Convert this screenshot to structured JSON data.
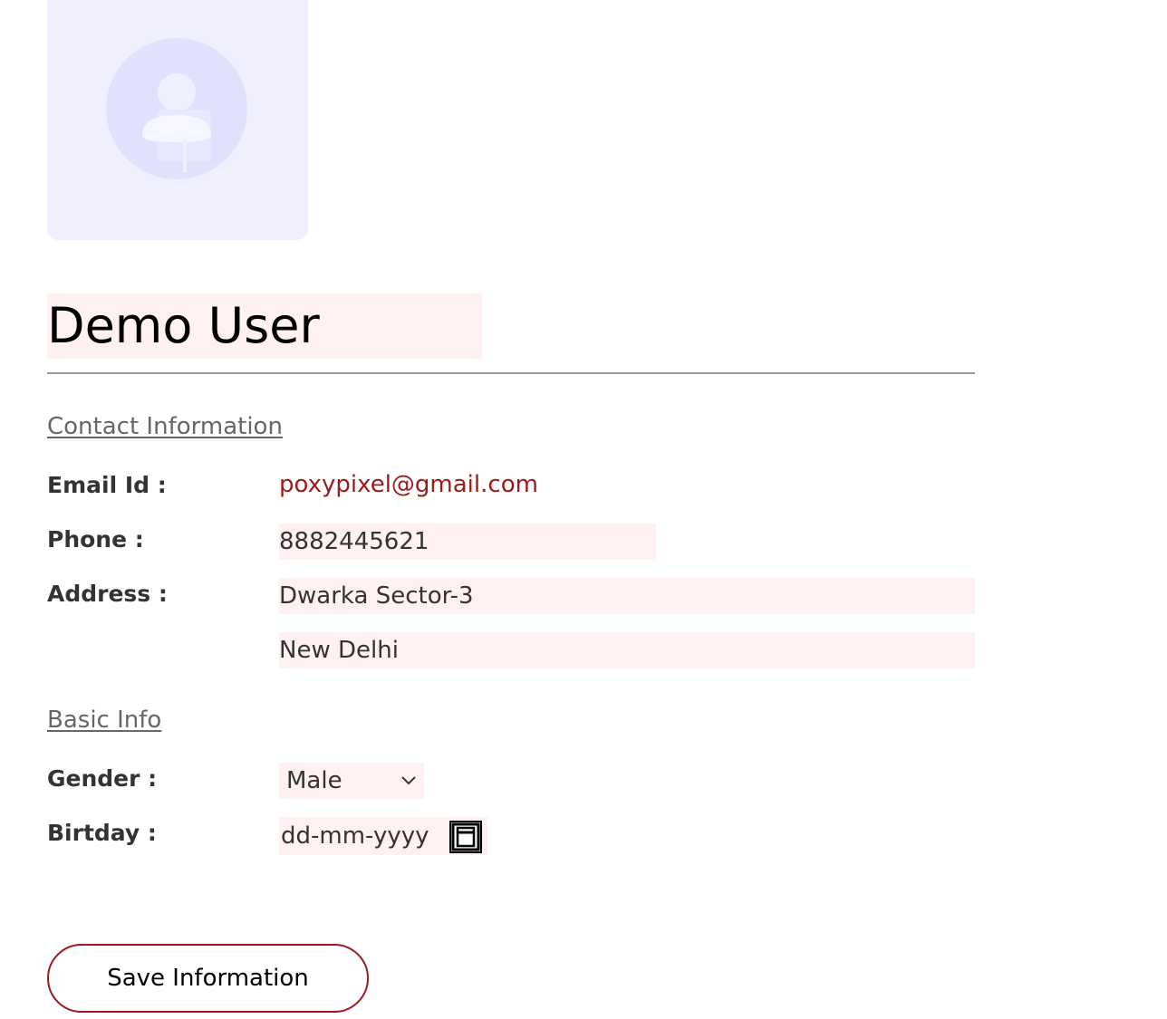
{
  "profile": {
    "name": "Demo User",
    "avatar_icon": "user-placeholder-icon"
  },
  "contact": {
    "heading": "Contact Information",
    "email_label": "Email Id :",
    "email_value": "poxypixel@gmail.com",
    "phone_label": "Phone :",
    "phone_value": "8882445621",
    "address_label": "Address :",
    "address_line1": "Dwarka Sector-3",
    "address_line2": "New Delhi"
  },
  "basic": {
    "heading": "Basic Info",
    "gender_label": "Gender :",
    "gender_value": "Male",
    "birthday_label": "Birtday :",
    "birthday_placeholder": "dd-mm-yyyy"
  },
  "actions": {
    "save_label": "Save Information"
  },
  "colors": {
    "accent": "#9b1b1b",
    "field_bg": "#fff1f1",
    "avatar_bg": "#efeffd"
  }
}
